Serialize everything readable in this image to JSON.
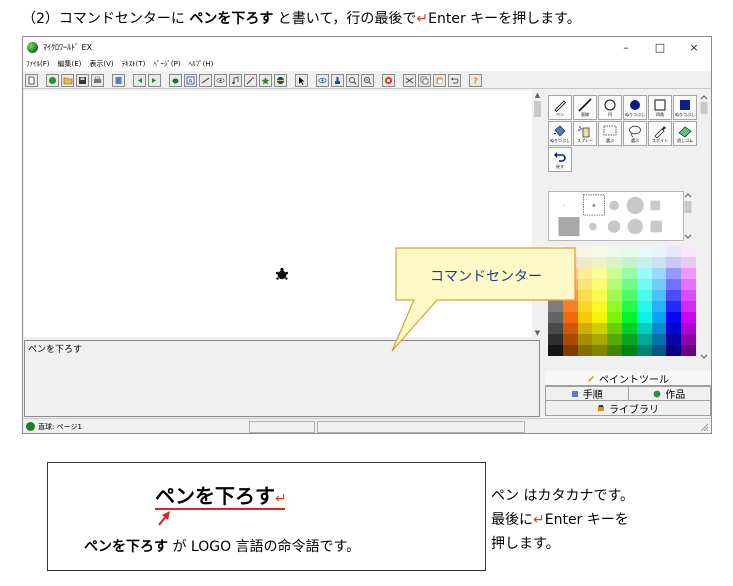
{
  "heading": {
    "prefix": "（2）コマンドセンターに ",
    "bold": "ペンを下ろす",
    "middle": " と書いて，行の最後で",
    "enter_mark": "↵",
    "suffix": "Enter キーを押します。"
  },
  "window": {
    "title": "ﾏｲｸﾛﾜｰﾙﾄﾞ EX",
    "minimize": "–",
    "maximize": "□",
    "close": "×",
    "menu": [
      "ﾌｧｲﾙ(F)",
      "編集(E)",
      "表示(V)",
      "ﾃｷｽﾄ(T)",
      "ﾍﾟｰｼﾞ(P)",
      "ﾍﾙﾌﾟ(H)"
    ],
    "command_text": "ペンを下ろす",
    "status": "直球: ページ1"
  },
  "tools": [
    {
      "label": "ペン",
      "icon": "pen-icon"
    },
    {
      "label": "直線",
      "icon": "line-icon"
    },
    {
      "label": "円",
      "icon": "circle-icon"
    },
    {
      "label": "ぬりつぶし",
      "icon": "filled-circle-icon"
    },
    {
      "label": "四角",
      "icon": "square-icon"
    },
    {
      "label": "ぬりつぶし",
      "icon": "filled-square-icon"
    },
    {
      "label": "ぬりつぶし",
      "icon": "bucket-icon"
    },
    {
      "label": "スプレー",
      "icon": "spray-icon"
    },
    {
      "label": "選ぶ",
      "icon": "rect-select-icon"
    },
    {
      "label": "選ぶ",
      "icon": "lasso-icon"
    },
    {
      "label": "スポイト",
      "icon": "eyedropper-icon"
    },
    {
      "label": "消しゴム",
      "icon": "eraser-icon"
    },
    {
      "label": "戻す",
      "icon": "undo-icon"
    }
  ],
  "tabs": {
    "paint": "ペイントツール",
    "procedures": "手順",
    "works": "作品",
    "library": "ライブラリ"
  },
  "callout": "コマンドセンター",
  "note": {
    "command": "ペンを下ろす",
    "enter_mark": "↵",
    "line_bold": "ペンを下ろす",
    "line_rest": " が LOGO 言語の命令語です。"
  },
  "side_note": {
    "line1": "ペン はカタカナです。",
    "line2_prefix": "最後に",
    "line2_mark": "↵",
    "line2_suffix": "Enter キーを",
    "line3": "押します。"
  },
  "colors": {
    "accent_red": "#d22a22",
    "callout_fill": "#fff9c8",
    "callout_stroke": "#d9a032",
    "callout_text": "#1a3f8a"
  }
}
